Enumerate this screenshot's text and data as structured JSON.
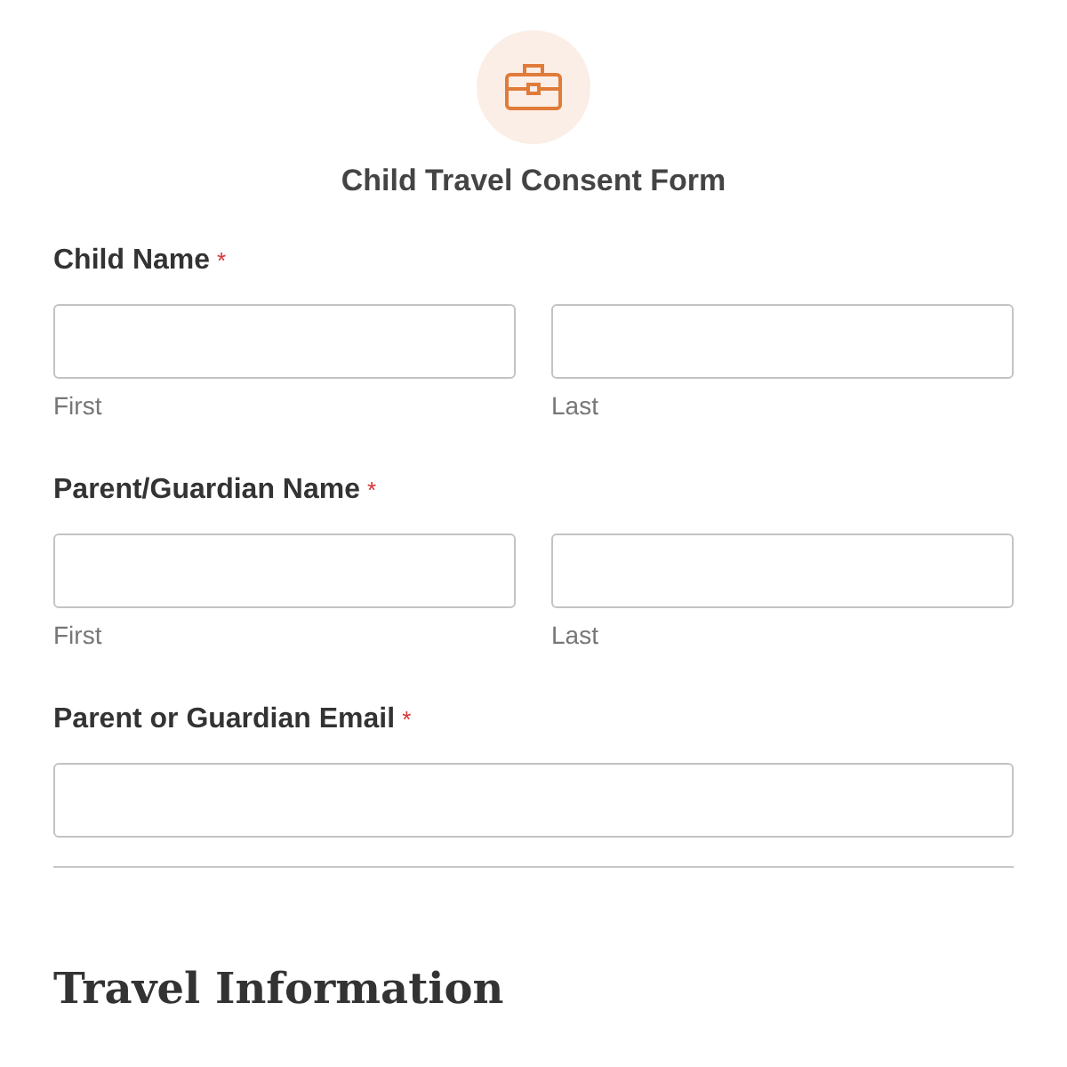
{
  "form": {
    "title": "Child Travel Consent Form"
  },
  "fields": [
    {
      "kind": "name",
      "label": "Child Name",
      "required_mark": "*",
      "sublabels": [
        "First",
        "Last"
      ]
    },
    {
      "kind": "name",
      "label": "Parent/Guardian Name",
      "required_mark": "*",
      "sublabels": [
        "First",
        "Last"
      ]
    },
    {
      "kind": "email",
      "label": "Parent or Guardian Email",
      "required_mark": "*"
    }
  ],
  "section": {
    "heading": "Travel Information"
  }
}
